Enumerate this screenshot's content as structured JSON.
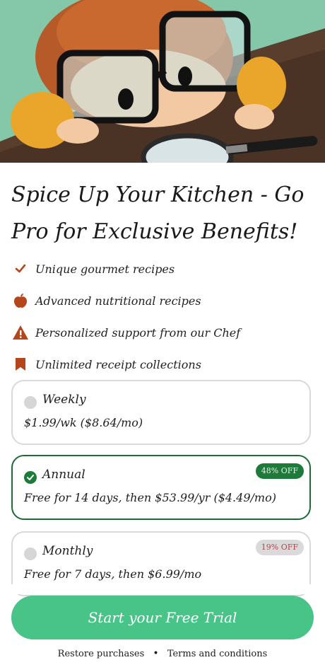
{
  "hero": {
    "image": "cartoon-child-with-glasses-and-magnifying-glass"
  },
  "title": "Spice Up Your Kitchen - Go Pro for Exclusive Benefits!",
  "features": [
    {
      "icon": "checkmark-icon",
      "label": "Unique gourmet recipes"
    },
    {
      "icon": "apple-icon",
      "label": "Advanced nutritional recipes"
    },
    {
      "icon": "warning-icon",
      "label": "Personalized support from our Chef"
    },
    {
      "icon": "bookmark-icon",
      "label": "Unlimited receipt collections"
    }
  ],
  "plans": [
    {
      "name": "Weekly",
      "price": "$1.99/wk ($8.64/mo)",
      "badge": "",
      "selected": false
    },
    {
      "name": "Annual",
      "price": "Free for 14 days, then $53.99/yr ($4.49/mo)",
      "badge": "48% OFF",
      "selected": true
    },
    {
      "name": "Monthly",
      "price": "Free for 7 days, then $6.99/mo",
      "badge": "19% OFF",
      "selected": false
    }
  ],
  "cta": {
    "label": "Start your Free Trial"
  },
  "footer": {
    "restore": "Restore purchases",
    "terms": "Terms and conditions"
  },
  "colors": {
    "accent": "#48c488",
    "selected_border": "#1c6b35",
    "feature_icon": "#b5451b"
  }
}
